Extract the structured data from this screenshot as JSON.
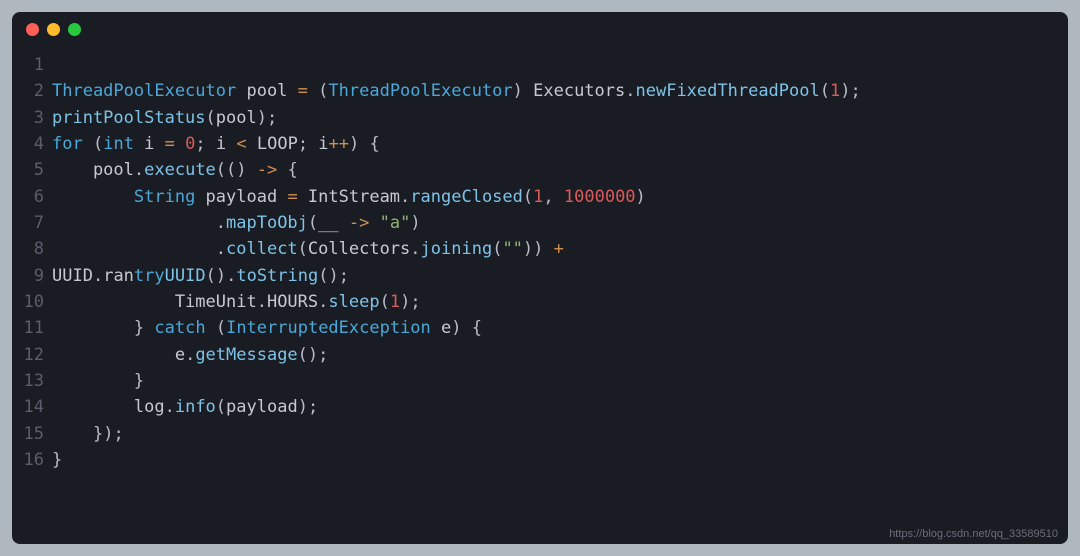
{
  "titlebar": {
    "red_label": "close",
    "yellow_label": "minimize",
    "green_label": "maximize"
  },
  "code": {
    "lines": [
      {
        "n": "1",
        "tokens": [
          {
            "t": ""
          }
        ]
      },
      {
        "n": "2",
        "tokens": [
          {
            "t": "ThreadPoolExecutor",
            "c": "tk-type"
          },
          {
            "t": " pool "
          },
          {
            "t": "=",
            "c": "tk-operator"
          },
          {
            "t": " "
          },
          {
            "t": "(",
            "c": "tk-punct"
          },
          {
            "t": "ThreadPoolExecutor",
            "c": "tk-type"
          },
          {
            "t": ")",
            "c": "tk-punct"
          },
          {
            "t": " Executors"
          },
          {
            "t": ".",
            "c": "tk-punct"
          },
          {
            "t": "newFixedThreadPool",
            "c": "tk-method"
          },
          {
            "t": "(",
            "c": "tk-punct"
          },
          {
            "t": "1",
            "c": "tk-number"
          },
          {
            "t": ")",
            "c": "tk-punct"
          },
          {
            "t": ";",
            "c": "tk-punct"
          }
        ]
      },
      {
        "n": "3",
        "tokens": [
          {
            "t": "printPoolStatus",
            "c": "tk-method"
          },
          {
            "t": "(",
            "c": "tk-punct"
          },
          {
            "t": "pool"
          },
          {
            "t": ")",
            "c": "tk-punct"
          },
          {
            "t": ";",
            "c": "tk-punct"
          }
        ]
      },
      {
        "n": "4",
        "tokens": [
          {
            "t": "for",
            "c": "tk-keyword"
          },
          {
            "t": " "
          },
          {
            "t": "(",
            "c": "tk-punct"
          },
          {
            "t": "int",
            "c": "tk-keyword"
          },
          {
            "t": " i "
          },
          {
            "t": "=",
            "c": "tk-operator"
          },
          {
            "t": " "
          },
          {
            "t": "0",
            "c": "tk-number"
          },
          {
            "t": ";",
            "c": "tk-punct"
          },
          {
            "t": " i "
          },
          {
            "t": "<",
            "c": "tk-operator"
          },
          {
            "t": " LOOP"
          },
          {
            "t": ";",
            "c": "tk-punct"
          },
          {
            "t": " i"
          },
          {
            "t": "++",
            "c": "tk-operator"
          },
          {
            "t": ")",
            "c": "tk-punct"
          },
          {
            "t": " "
          },
          {
            "t": "{",
            "c": "tk-punct"
          }
        ]
      },
      {
        "n": "5",
        "tokens": [
          {
            "t": "    pool"
          },
          {
            "t": ".",
            "c": "tk-punct"
          },
          {
            "t": "execute",
            "c": "tk-method"
          },
          {
            "t": "(",
            "c": "tk-punct"
          },
          {
            "t": "(",
            "c": "tk-punct"
          },
          {
            "t": ")",
            "c": "tk-punct"
          },
          {
            "t": " "
          },
          {
            "t": "->",
            "c": "tk-operator"
          },
          {
            "t": " "
          },
          {
            "t": "{",
            "c": "tk-punct"
          }
        ]
      },
      {
        "n": "6",
        "tokens": [
          {
            "t": "        "
          },
          {
            "t": "String",
            "c": "tk-type"
          },
          {
            "t": " payload "
          },
          {
            "t": "=",
            "c": "tk-operator"
          },
          {
            "t": " IntStream"
          },
          {
            "t": ".",
            "c": "tk-punct"
          },
          {
            "t": "rangeClosed",
            "c": "tk-method"
          },
          {
            "t": "(",
            "c": "tk-punct"
          },
          {
            "t": "1",
            "c": "tk-number"
          },
          {
            "t": ",",
            "c": "tk-punct"
          },
          {
            "t": " "
          },
          {
            "t": "1000000",
            "c": "tk-number"
          },
          {
            "t": ")",
            "c": "tk-punct"
          }
        ]
      },
      {
        "n": "7",
        "tokens": [
          {
            "t": "                "
          },
          {
            "t": ".",
            "c": "tk-punct"
          },
          {
            "t": "mapToObj",
            "c": "tk-method"
          },
          {
            "t": "(",
            "c": "tk-punct"
          },
          {
            "t": "__ "
          },
          {
            "t": "->",
            "c": "tk-operator"
          },
          {
            "t": " "
          },
          {
            "t": "\"a\"",
            "c": "tk-string"
          },
          {
            "t": ")",
            "c": "tk-punct"
          }
        ]
      },
      {
        "n": "8",
        "tokens": [
          {
            "t": "                "
          },
          {
            "t": ".",
            "c": "tk-punct"
          },
          {
            "t": "collect",
            "c": "tk-method"
          },
          {
            "t": "(",
            "c": "tk-punct"
          },
          {
            "t": "Collectors"
          },
          {
            "t": ".",
            "c": "tk-punct"
          },
          {
            "t": "joining",
            "c": "tk-method"
          },
          {
            "t": "(",
            "c": "tk-punct"
          },
          {
            "t": "\"\"",
            "c": "tk-string"
          },
          {
            "t": ")",
            "c": "tk-punct"
          },
          {
            "t": ")",
            "c": "tk-punct"
          },
          {
            "t": " "
          },
          {
            "t": "+",
            "c": "tk-operator"
          }
        ]
      },
      {
        "n": "9",
        "tokens": [
          {
            "t": "UUID"
          },
          {
            "t": ".",
            "c": "tk-punct"
          },
          {
            "t": "ran"
          },
          {
            "t": "try",
            "c": "tk-keyword"
          },
          {
            "t": "UUID",
            "c": "tk-method"
          },
          {
            "t": "(",
            "c": "tk-punct"
          },
          {
            "t": ")",
            "c": "tk-punct"
          },
          {
            "t": ".",
            "c": "tk-punct"
          },
          {
            "t": "toString",
            "c": "tk-method"
          },
          {
            "t": "(",
            "c": "tk-punct"
          },
          {
            "t": ")",
            "c": "tk-punct"
          },
          {
            "t": ";",
            "c": "tk-punct"
          }
        ]
      },
      {
        "n": "10",
        "tokens": [
          {
            "t": "            TimeUnit"
          },
          {
            "t": ".",
            "c": "tk-punct"
          },
          {
            "t": "HOURS"
          },
          {
            "t": ".",
            "c": "tk-punct"
          },
          {
            "t": "sleep",
            "c": "tk-method"
          },
          {
            "t": "(",
            "c": "tk-punct"
          },
          {
            "t": "1",
            "c": "tk-number"
          },
          {
            "t": ")",
            "c": "tk-punct"
          },
          {
            "t": ";",
            "c": "tk-punct"
          }
        ]
      },
      {
        "n": "11",
        "tokens": [
          {
            "t": "        "
          },
          {
            "t": "}",
            "c": "tk-punct"
          },
          {
            "t": " "
          },
          {
            "t": "catch",
            "c": "tk-keyword"
          },
          {
            "t": " "
          },
          {
            "t": "(",
            "c": "tk-punct"
          },
          {
            "t": "InterruptedException",
            "c": "tk-type"
          },
          {
            "t": " e"
          },
          {
            "t": ")",
            "c": "tk-punct"
          },
          {
            "t": " "
          },
          {
            "t": "{",
            "c": "tk-punct"
          }
        ]
      },
      {
        "n": "12",
        "tokens": [
          {
            "t": "            e"
          },
          {
            "t": ".",
            "c": "tk-punct"
          },
          {
            "t": "getMessage",
            "c": "tk-method"
          },
          {
            "t": "(",
            "c": "tk-punct"
          },
          {
            "t": ")",
            "c": "tk-punct"
          },
          {
            "t": ";",
            "c": "tk-punct"
          }
        ]
      },
      {
        "n": "13",
        "tokens": [
          {
            "t": "        "
          },
          {
            "t": "}",
            "c": "tk-punct"
          }
        ]
      },
      {
        "n": "14",
        "tokens": [
          {
            "t": "        log"
          },
          {
            "t": ".",
            "c": "tk-punct"
          },
          {
            "t": "info",
            "c": "tk-method"
          },
          {
            "t": "(",
            "c": "tk-punct"
          },
          {
            "t": "payload"
          },
          {
            "t": ")",
            "c": "tk-punct"
          },
          {
            "t": ";",
            "c": "tk-punct"
          }
        ]
      },
      {
        "n": "15",
        "tokens": [
          {
            "t": "    "
          },
          {
            "t": "}",
            "c": "tk-punct"
          },
          {
            "t": ")",
            "c": "tk-punct"
          },
          {
            "t": ";",
            "c": "tk-punct"
          }
        ]
      },
      {
        "n": "16",
        "tokens": [
          {
            "t": "}",
            "c": "tk-punct"
          }
        ]
      }
    ]
  },
  "watermark": "https://blog.csdn.net/qq_33589510"
}
